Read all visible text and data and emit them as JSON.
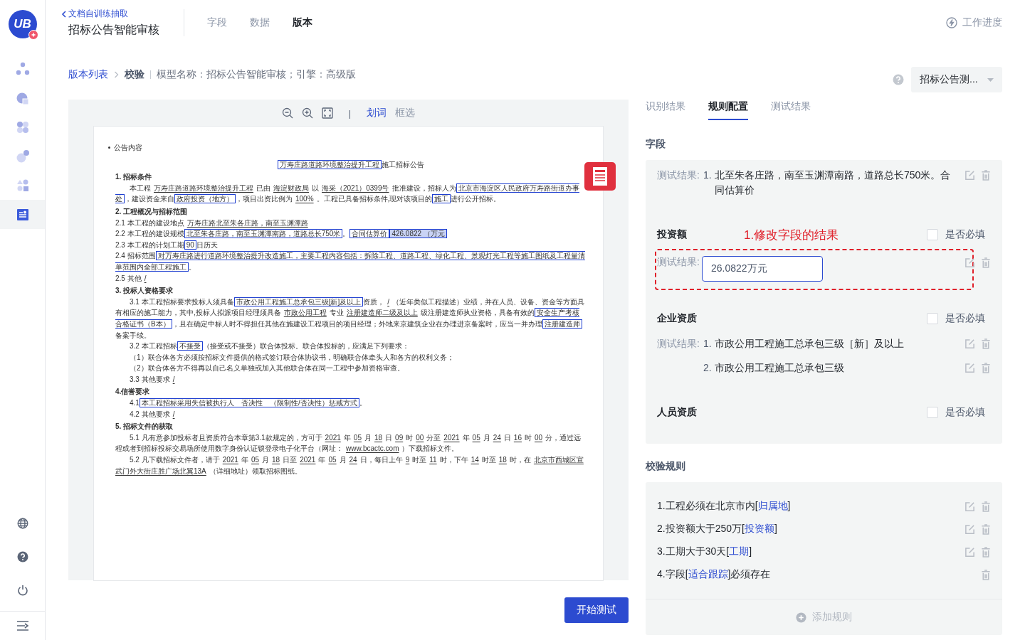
{
  "sidebar": {
    "logo": "UB",
    "items": [
      {
        "selected": false
      },
      {
        "selected": false
      },
      {
        "selected": false
      },
      {
        "selected": false
      },
      {
        "selected": false
      },
      {
        "selected": true
      }
    ]
  },
  "header": {
    "back_link": "文档自训练抽取",
    "title": "招标公告智能审核",
    "tabs": [
      {
        "label": "字段",
        "selected": false
      },
      {
        "label": "数据",
        "selected": false
      },
      {
        "label": "版本",
        "selected": true
      }
    ],
    "progress": "工作进度"
  },
  "breadcrumb": {
    "link": "版本列表",
    "current": "校验",
    "info": "模型名称：招标公告智能审核；引擎：高级版"
  },
  "viewer": {
    "separator": "|",
    "modes": [
      {
        "label": "划词",
        "selected": true
      },
      {
        "label": "框选",
        "selected": false
      }
    ],
    "document": [
      {
        "kind": "bullet",
        "segments": [
          {
            "kind": "plain",
            "text": "公告内容"
          }
        ]
      },
      {
        "kind": "title",
        "segments": [
          {
            "kind": "box",
            "text": "万寿庄路道路环境整治提升工程"
          },
          {
            "kind": "plain",
            "text": "施工招标公告"
          }
        ]
      },
      {
        "kind": "heading",
        "segments": [
          {
            "kind": "plain",
            "text": "1. 招标条件"
          }
        ]
      },
      {
        "kind": "para",
        "segments": [
          {
            "kind": "plain",
            "text": "本工程"
          },
          {
            "kind": "fill",
            "text": "万寿庄路道路环境整治提升工程"
          },
          {
            "kind": "plain",
            "text": "已由"
          },
          {
            "kind": "fill",
            "text": "海淀财政局"
          },
          {
            "kind": "plain",
            "text": "以"
          },
          {
            "kind": "fill",
            "text": "海采（2021）0399号"
          },
          {
            "kind": "plain",
            "text": "批准建设，招标人为"
          },
          {
            "kind": "box",
            "text": "北京市海淀区人民政府万寿路街道办事处"
          },
          {
            "kind": "plain",
            "text": "，建设资金来自"
          },
          {
            "kind": "box",
            "text": "政府投资（地方）"
          },
          {
            "kind": "plain",
            "text": "，项目出资比例为"
          },
          {
            "kind": "fill",
            "text": "100%"
          },
          {
            "kind": "plain",
            "text": "。工程已具备招标条件,现对该项目的"
          },
          {
            "kind": "box",
            "text": "施工"
          },
          {
            "kind": "plain",
            "text": "进行公开招标。"
          }
        ]
      },
      {
        "kind": "heading",
        "segments": [
          {
            "kind": "plain",
            "text": "2. 工程概况与招标范围"
          }
        ]
      },
      {
        "kind": "item",
        "segments": [
          {
            "kind": "plain",
            "text": "2.1 本工程的建设地点"
          },
          {
            "kind": "fill",
            "text": "万寿庄路北至朱各庄路，南至玉渊潭路"
          }
        ]
      },
      {
        "kind": "item",
        "segments": [
          {
            "kind": "plain",
            "text": "2.2 本工程的建设规模"
          },
          {
            "kind": "box",
            "text": "北至朱各庄路，南至玉渊潭南路，道路总长750米"
          },
          {
            "kind": "plain",
            "text": "。"
          },
          {
            "kind": "box",
            "text": "合同估算价"
          },
          {
            "kind": "mark",
            "text": "426.0822 （万元"
          }
        ]
      },
      {
        "kind": "item",
        "segments": [
          {
            "kind": "plain",
            "text": "2.3 本工程的计划工期"
          },
          {
            "kind": "box",
            "text": "90"
          },
          {
            "kind": "plain",
            "text": "日历天"
          }
        ]
      },
      {
        "kind": "item",
        "segments": [
          {
            "kind": "plain",
            "text": "2.4 招标范围"
          },
          {
            "kind": "box",
            "text": "对万寿庄路进行道路环境整治提升改造施工，主要工程内容包括：拆除工程、道路工程、绿化工程、景观灯光工程等施工图纸及工程量清单范围内全部工程施工"
          },
          {
            "kind": "plain",
            "text": "。"
          }
        ]
      },
      {
        "kind": "item",
        "segments": [
          {
            "kind": "plain",
            "text": "2.5 其他"
          },
          {
            "kind": "fill",
            "text": "/"
          }
        ]
      },
      {
        "kind": "heading",
        "segments": [
          {
            "kind": "plain",
            "text": "3. 投标人资格要求"
          }
        ]
      },
      {
        "kind": "para",
        "segments": [
          {
            "kind": "plain",
            "text": "3.1 本工程招标要求投标人须具备"
          },
          {
            "kind": "box",
            "text": "市政公用工程施工总承包三级[新]及以上"
          },
          {
            "kind": "plain",
            "text": "资质，"
          },
          {
            "kind": "fill",
            "text": "/"
          },
          {
            "kind": "plain",
            "text": "（近年类似工程描述）业绩，并在人员、设备、资金等方面具有相应的施工能力，其中,投标人拟派项目经理须具备"
          },
          {
            "kind": "fill",
            "text": "市政公用工程"
          },
          {
            "kind": "plain",
            "text": "专业"
          },
          {
            "kind": "fill",
            "text": "注册建造师二级及以上"
          },
          {
            "kind": "plain",
            "text": "级注册建造师执业资格，具备有效的"
          },
          {
            "kind": "box",
            "text": "安全生产考核合格证书（B本）"
          },
          {
            "kind": "plain",
            "text": "，且在确定中标人时不得担任其他在施建设工程项目的项目经理；外地来京建筑企业在办理进京备案时，应当一并办理"
          },
          {
            "kind": "box",
            "text": "注册建造师"
          },
          {
            "kind": "plain",
            "text": "备案手续。"
          }
        ]
      },
      {
        "kind": "para",
        "segments": [
          {
            "kind": "plain",
            "text": "3.2 本工程招标"
          },
          {
            "kind": "box",
            "text": "不接受"
          },
          {
            "kind": "plain",
            "text": "（接受或不接受）联合体投标。联合体投标的，应满足下列要求："
          }
        ]
      },
      {
        "kind": "para",
        "segments": [
          {
            "kind": "plain",
            "text": "（1）联合体各方必须按招标文件提供的格式签订联合体协议书，明确联合体牵头人和各方的权利义务；"
          }
        ]
      },
      {
        "kind": "para",
        "segments": [
          {
            "kind": "plain",
            "text": "（2）联合体各方不得再以自己名义单独或加入其他联合体在同一工程中参加资格审查。"
          }
        ]
      },
      {
        "kind": "para",
        "segments": [
          {
            "kind": "plain",
            "text": "3.3 其他要求"
          },
          {
            "kind": "fill",
            "text": "/"
          }
        ]
      },
      {
        "kind": "heading",
        "segments": [
          {
            "kind": "plain",
            "text": "4.信誉要求"
          }
        ]
      },
      {
        "kind": "para",
        "segments": [
          {
            "kind": "plain",
            "text": "4.1"
          },
          {
            "kind": "box",
            "text": "本工程招标采用失信被执行人　否决性　（限制性/否决性）惩戒方式"
          },
          {
            "kind": "plain",
            "text": "。"
          }
        ]
      },
      {
        "kind": "para",
        "segments": [
          {
            "kind": "plain",
            "text": "4.2 其他要求"
          },
          {
            "kind": "fill",
            "text": "/"
          }
        ]
      },
      {
        "kind": "heading",
        "segments": [
          {
            "kind": "plain",
            "text": "5. 招标文件的获取"
          }
        ]
      },
      {
        "kind": "para",
        "segments": [
          {
            "kind": "plain",
            "text": "5.1 凡有意参加投标者且资质符合本章第3.1款规定的，方可于"
          },
          {
            "kind": "fill",
            "text": "2021"
          },
          {
            "kind": "plain",
            "text": "年"
          },
          {
            "kind": "fill",
            "text": "05"
          },
          {
            "kind": "plain",
            "text": "月"
          },
          {
            "kind": "fill",
            "text": "18"
          },
          {
            "kind": "plain",
            "text": "日"
          },
          {
            "kind": "fill",
            "text": "09"
          },
          {
            "kind": "plain",
            "text": "时"
          },
          {
            "kind": "fill",
            "text": "00"
          },
          {
            "kind": "plain",
            "text": "分至"
          },
          {
            "kind": "fill",
            "text": "2021"
          },
          {
            "kind": "plain",
            "text": "年"
          },
          {
            "kind": "fill",
            "text": "05"
          },
          {
            "kind": "plain",
            "text": "月"
          },
          {
            "kind": "fill",
            "text": "24"
          },
          {
            "kind": "plain",
            "text": "日"
          },
          {
            "kind": "fill",
            "text": "16"
          },
          {
            "kind": "plain",
            "text": "时"
          },
          {
            "kind": "fill",
            "text": "00"
          },
          {
            "kind": "plain",
            "text": "分，通过远程或者到招标投标交易场所使用数字身份认证锁登录电子化平台（网址："
          },
          {
            "kind": "fill",
            "text": "www.bcactc.com"
          },
          {
            "kind": "plain",
            "text": "）下载招标文件。"
          }
        ]
      },
      {
        "kind": "para",
        "segments": [
          {
            "kind": "plain",
            "text": "5.2 凡下载招标文件者，请于"
          },
          {
            "kind": "fill",
            "text": "2021"
          },
          {
            "kind": "plain",
            "text": "年"
          },
          {
            "kind": "fill",
            "text": "05"
          },
          {
            "kind": "plain",
            "text": "月"
          },
          {
            "kind": "fill",
            "text": "18"
          },
          {
            "kind": "plain",
            "text": "日至"
          },
          {
            "kind": "fill",
            "text": "2021"
          },
          {
            "kind": "plain",
            "text": "年"
          },
          {
            "kind": "fill",
            "text": "05"
          },
          {
            "kind": "plain",
            "text": "月"
          },
          {
            "kind": "fill",
            "text": "24"
          },
          {
            "kind": "plain",
            "text": "日，每日上午"
          },
          {
            "kind": "fill",
            "text": "9"
          },
          {
            "kind": "plain",
            "text": "时至"
          },
          {
            "kind": "fill",
            "text": "11"
          },
          {
            "kind": "plain",
            "text": "时，下午"
          },
          {
            "kind": "fill",
            "text": "14"
          },
          {
            "kind": "plain",
            "text": "时至"
          },
          {
            "kind": "fill",
            "text": "18"
          },
          {
            "kind": "plain",
            "text": "时，在"
          },
          {
            "kind": "fill",
            "text": "北京市西城区宣武门外大街庄胜广场北翼13A"
          },
          {
            "kind": "plain",
            "text": "（详细地址）领取招标图纸。"
          }
        ]
      }
    ]
  },
  "start_button": "开始测试",
  "panel": {
    "dropdown": "招标公告测...",
    "tabs": [
      {
        "label": "识别结果",
        "selected": false
      },
      {
        "label": "规则配置",
        "selected": true
      },
      {
        "label": "测试结果",
        "selected": false
      }
    ],
    "fields_title": "字段",
    "fields": [
      {
        "result_label": "测试结果:",
        "results": [
          {
            "index": "1.",
            "text": "北至朱各庄路，南至玉渊潭南路，道路总长750米。合同估算价"
          }
        ]
      },
      {
        "name": "投资额",
        "required": false,
        "required_label": "是否必填",
        "annotation": "1.修改字段的结果",
        "result_label": "测试结果:",
        "input_value": "26.0822万元"
      },
      {
        "name": "企业资质",
        "required": false,
        "required_label": "是否必填",
        "result_label": "测试结果:",
        "results": [
          {
            "index": "1.",
            "text": "市政公用工程施工总承包三级［新］及以上"
          },
          {
            "index": "2.",
            "text": "市政公用工程施工总承包三级"
          }
        ]
      },
      {
        "name": "人员资质",
        "required": false,
        "required_label": "是否必填"
      }
    ],
    "rules_title": "校验规则",
    "rules": [
      {
        "editable": true,
        "segments": [
          {
            "text": "1.工程必须在北京市内[",
            "link": false
          },
          {
            "text": "归属地",
            "link": true
          },
          {
            "text": "]",
            "link": false
          }
        ]
      },
      {
        "editable": true,
        "segments": [
          {
            "text": "2.投资额大于250万[",
            "link": false
          },
          {
            "text": "投资额",
            "link": true
          },
          {
            "text": "]",
            "link": false
          }
        ]
      },
      {
        "editable": true,
        "segments": [
          {
            "text": "3.工期大于30天[",
            "link": false
          },
          {
            "text": "工期",
            "link": true
          },
          {
            "text": "]",
            "link": false
          }
        ]
      },
      {
        "editable": false,
        "segments": [
          {
            "text": "4.字段[",
            "link": false
          },
          {
            "text": "适合跟踪",
            "link": true
          },
          {
            "text": "]必须存在",
            "link": false
          }
        ]
      }
    ],
    "add_rule": "添加规则"
  }
}
